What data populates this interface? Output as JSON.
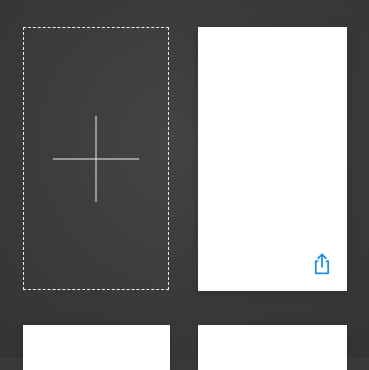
{
  "screen": {
    "background": "#3a3a3a"
  },
  "add_slot": {
    "icon": "plus-icon",
    "border_color": "#f2f2f2"
  },
  "cards": [
    {
      "name": "card-main",
      "share_icon": "share-icon",
      "share_color": "#1e8ee8"
    },
    {
      "name": "card-bottom-left"
    },
    {
      "name": "card-bottom-right"
    }
  ]
}
